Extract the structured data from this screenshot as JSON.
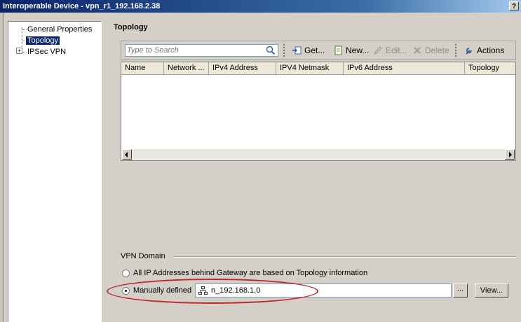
{
  "window": {
    "title": "Interoperable Device - vpn_r1_192.168.2.38",
    "help_label": "?"
  },
  "tree": {
    "items": [
      {
        "label": "General Properties"
      },
      {
        "label": "Topology"
      },
      {
        "label": "IPSec VPN"
      }
    ],
    "expander": "+"
  },
  "topology": {
    "title": "Topology",
    "search": {
      "placeholder": "Type to Search"
    },
    "toolbar": {
      "get": "Get...",
      "new": "New...",
      "edit": "Edit...",
      "delete": "Delete",
      "actions": "Actions"
    },
    "columns": [
      "Name",
      "Network ...",
      "IPv4 Address",
      "IPV4 Netmask",
      "IPv6 Address",
      "Topology"
    ],
    "rows": []
  },
  "vpn_domain": {
    "label": "VPN Domain",
    "option_all": "All IP Addresses behind Gateway are based on Topology information",
    "option_manual": "Manually defined",
    "selected": "manual",
    "manual_value": "n_192.168.1.0",
    "browse_label": "...",
    "view_label": "View..."
  },
  "colors": {
    "selection": "#0a246a",
    "highlight_ring": "#c0262d",
    "title_bar": "#0a246a"
  }
}
